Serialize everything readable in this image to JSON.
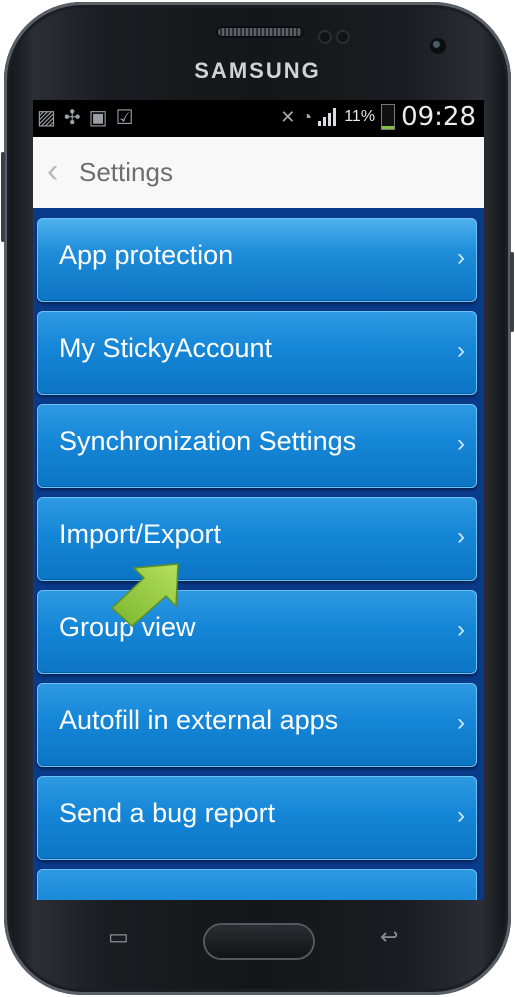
{
  "device": {
    "brand": "SAMSUNG"
  },
  "status_bar": {
    "notification_icons": [
      "image-icon",
      "pinwheel-icon",
      "media-icon",
      "clipboard-check-icon"
    ],
    "battery_percent": "11%",
    "battery_level": 0.11,
    "time": "09:28"
  },
  "header": {
    "title": "Settings"
  },
  "menu": {
    "items": [
      {
        "label": "App protection"
      },
      {
        "label": "My StickyAccount"
      },
      {
        "label": "Synchronization Settings"
      },
      {
        "label": "Import/Export"
      },
      {
        "label": "Group view"
      },
      {
        "label": "Autofill in external apps"
      },
      {
        "label": "Send a bug report"
      }
    ],
    "chevron": "›"
  },
  "colors": {
    "item_blue": "#1586d7",
    "list_background": "#0a3a8a",
    "arrow_green": "#8cc63f"
  }
}
